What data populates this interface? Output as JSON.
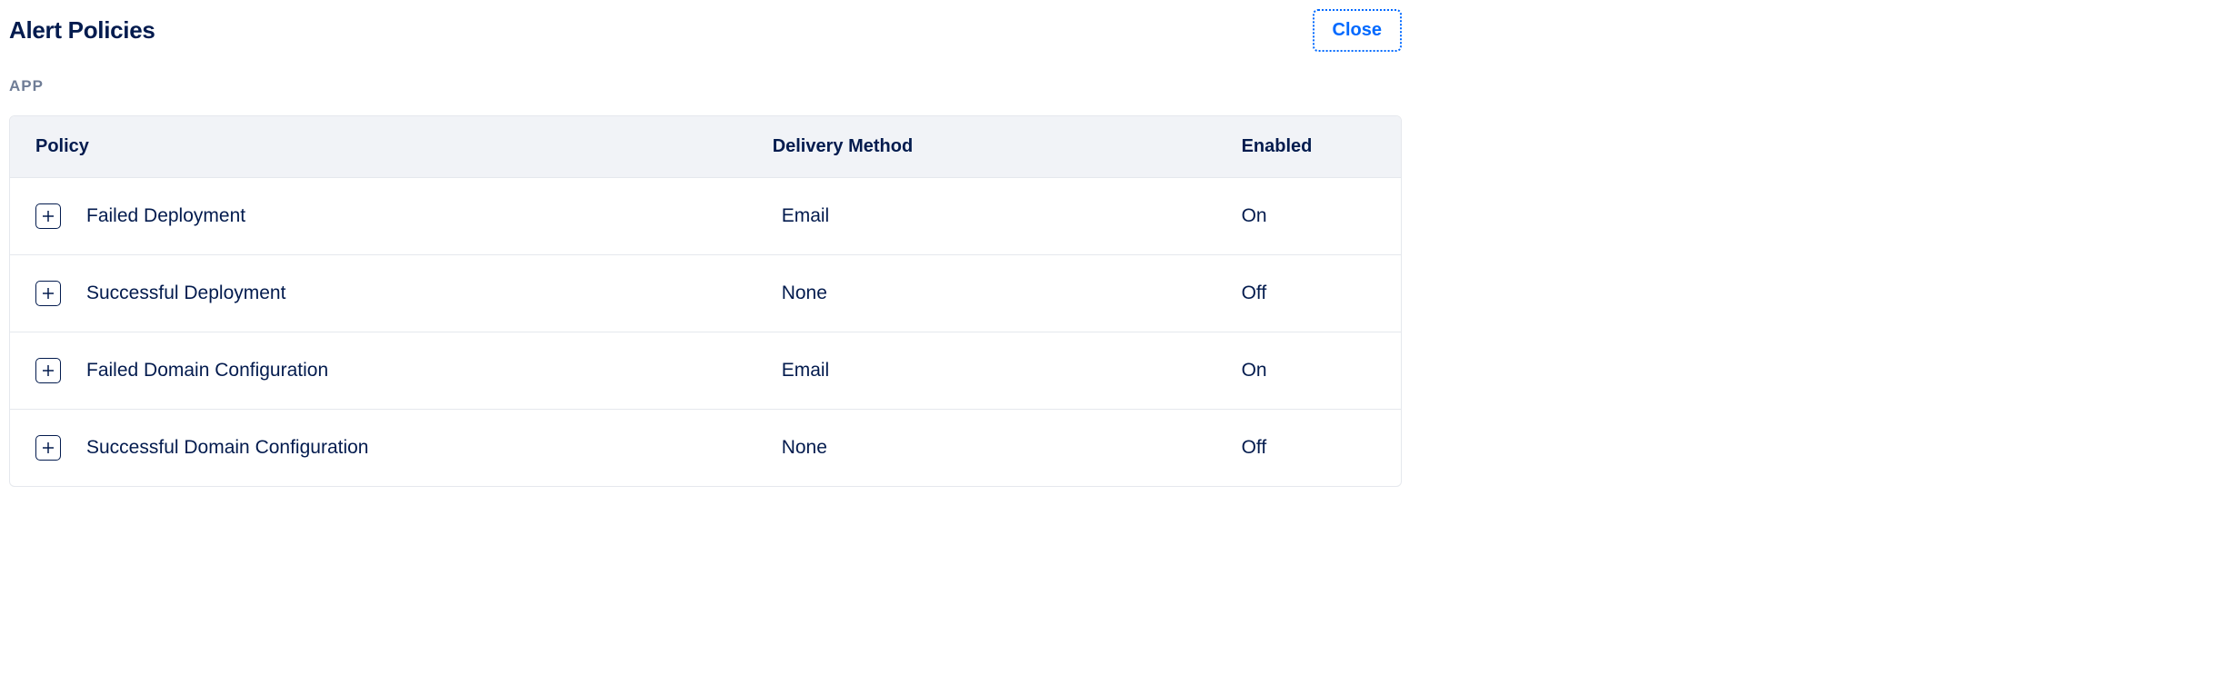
{
  "header": {
    "title": "Alert Policies",
    "close_label": "Close"
  },
  "section_label": "APP",
  "table": {
    "headers": {
      "policy": "Policy",
      "delivery": "Delivery Method",
      "enabled": "Enabled"
    },
    "rows": [
      {
        "policy": "Failed Deployment",
        "delivery": "Email",
        "enabled": "On"
      },
      {
        "policy": "Successful Deployment",
        "delivery": "None",
        "enabled": "Off"
      },
      {
        "policy": "Failed Domain Configuration",
        "delivery": "Email",
        "enabled": "On"
      },
      {
        "policy": "Successful Domain Configuration",
        "delivery": "None",
        "enabled": "Off"
      }
    ]
  }
}
